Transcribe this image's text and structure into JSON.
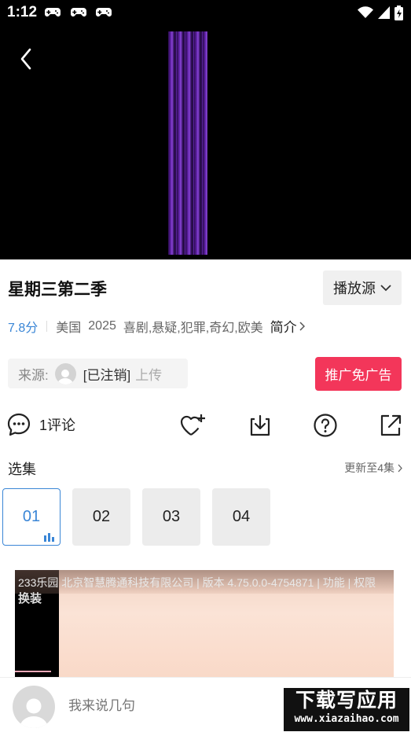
{
  "status_bar": {
    "time": "1:12"
  },
  "video": {
    "background_color": "#000000"
  },
  "show": {
    "title": "星期三第二季",
    "score": "7.8分",
    "region": "美国",
    "year": "2025",
    "genres": "喜剧,悬疑,犯罪,奇幻,欧美",
    "intro_label": "简介"
  },
  "source_select": {
    "label": "播放源"
  },
  "uploader": {
    "label": "来源:",
    "name": "[已注销]",
    "action": "上传"
  },
  "ad_free_button": {
    "label": "推广免广告",
    "color": "#f3365a"
  },
  "actions": {
    "comment_count_label": "1评论"
  },
  "episodes": {
    "section_title": "选集",
    "update_label": "更新至4集",
    "items": [
      "01",
      "02",
      "03",
      "04"
    ],
    "active_index": 0,
    "accent_color": "#3a86d6"
  },
  "ad": {
    "header_text": "233乐园 北京智慧腾通科技有限公司 | 版本 4.75.0.0-4754871 | 功能 | 权限",
    "sub_text": "换装"
  },
  "bottom_bar": {
    "comment_placeholder": "我来说几句"
  },
  "watermark": {
    "cn": "下载写应用",
    "en": "www.xiazaihao.com"
  }
}
